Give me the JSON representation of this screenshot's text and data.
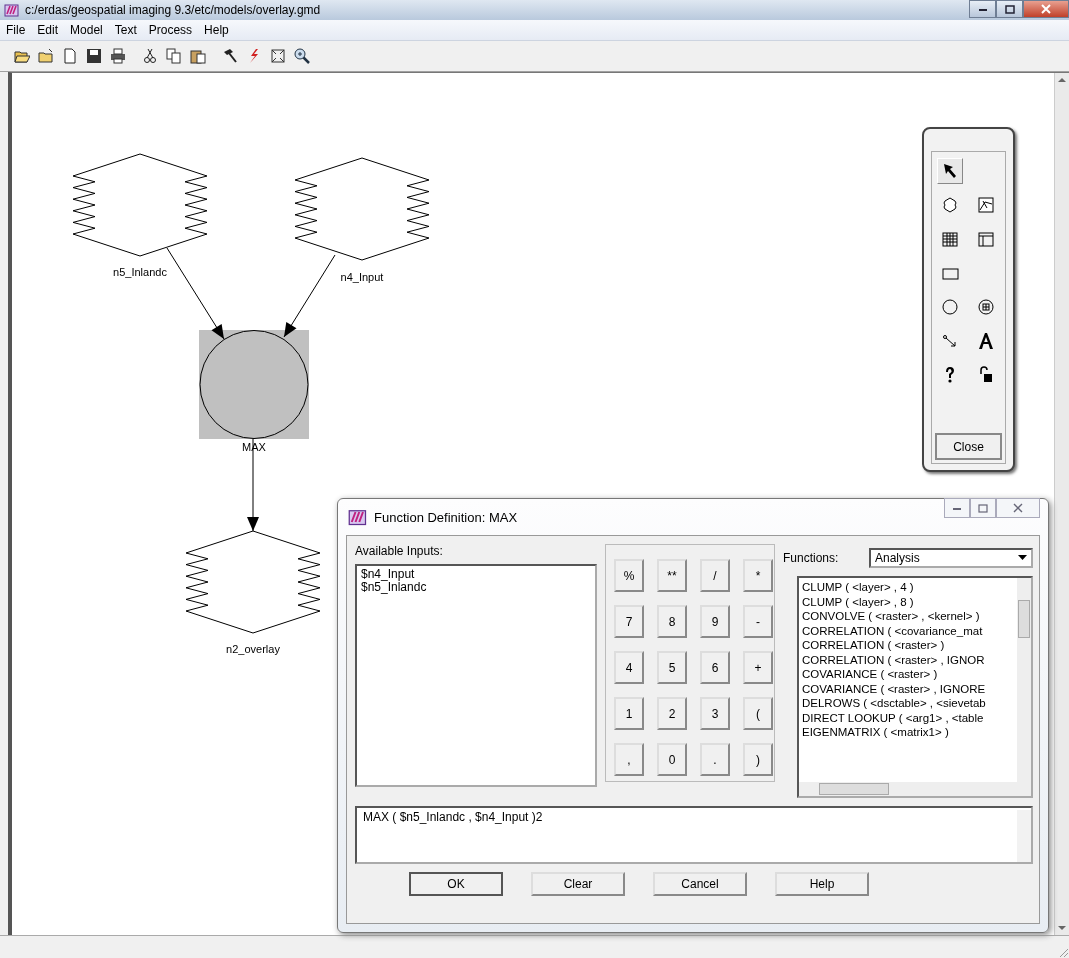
{
  "window": {
    "title": "c:/erdas/geospatial imaging 9.3/etc/models/overlay.gmd"
  },
  "menu": [
    "File",
    "Edit",
    "Model",
    "Text",
    "Process",
    "Help"
  ],
  "diagram": {
    "nodes": [
      {
        "kind": "raster",
        "label": "n5_Inlandc"
      },
      {
        "kind": "raster",
        "label": "n4_Input"
      },
      {
        "kind": "function",
        "label": "MAX"
      },
      {
        "kind": "raster",
        "label": "n2_overlay"
      }
    ]
  },
  "palette": {
    "tool_rows": [
      [
        {
          "kind": "pointer",
          "selected": true
        }
      ],
      [
        {
          "kind": "raster",
          "selected": false
        },
        {
          "kind": "vector",
          "selected": false
        }
      ],
      [
        {
          "kind": "matrix",
          "selected": false
        },
        {
          "kind": "table",
          "selected": false
        }
      ],
      [
        {
          "kind": "scalar",
          "selected": false
        }
      ],
      [
        {
          "kind": "function",
          "selected": false
        },
        {
          "kind": "criteria",
          "selected": false
        }
      ],
      [
        {
          "kind": "connect",
          "selected": false
        },
        {
          "kind": "text",
          "selected": false
        }
      ],
      [
        {
          "kind": "help",
          "selected": false
        },
        {
          "kind": "lock",
          "selected": false
        }
      ]
    ],
    "close_label": "Close"
  },
  "dialog": {
    "title": "Function Definition:  MAX",
    "inputs_label": "Available Inputs:",
    "inputs": [
      "$n4_Input",
      "$n5_Inlandc"
    ],
    "keypad": [
      "%",
      "**",
      "/",
      "*",
      "7",
      "8",
      "9",
      "-",
      "4",
      "5",
      "6",
      "+",
      "1",
      "2",
      "3",
      "(",
      ",",
      "0",
      ".",
      ")"
    ],
    "functions_label": "Functions:",
    "category": "Analysis",
    "functions": [
      "CLUMP ( <layer> , 4 )",
      "CLUMP ( <layer> , 8 )",
      "CONVOLVE ( <raster> , <kernel> )",
      "CORRELATION ( <covariance_mat",
      "CORRELATION ( <raster> )",
      "CORRELATION ( <raster> , IGNOR",
      "COVARIANCE ( <raster> )",
      "COVARIANCE ( <raster> , IGNORE",
      "DELROWS ( <dsctable> , <sievetab",
      "DIRECT LOOKUP ( <arg1> , <table",
      "EIGENMATRIX ( <matrix1> )"
    ],
    "expression": "MAX ( $n5_Inlandc , $n4_Input )2",
    "buttons": [
      "OK",
      "Clear",
      "Cancel",
      "Help"
    ]
  }
}
